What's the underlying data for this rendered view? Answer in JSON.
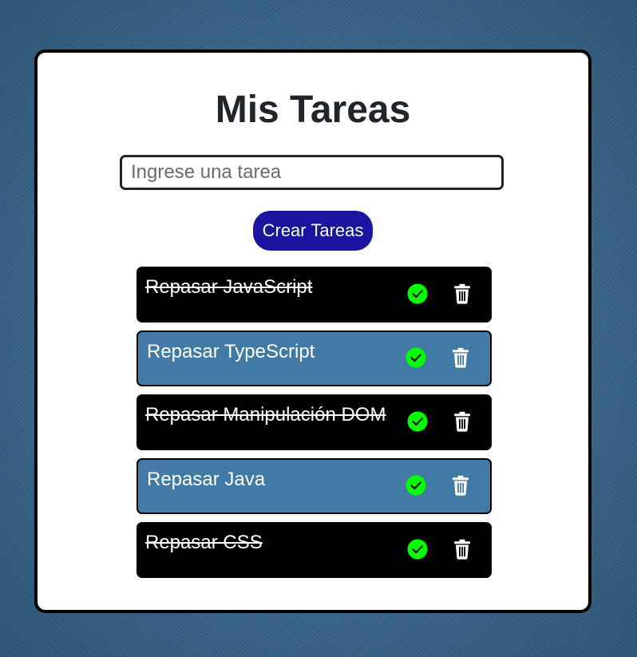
{
  "app": {
    "title": "Mis Tareas"
  },
  "form": {
    "input_placeholder": "Ingrese una tarea",
    "input_value": "",
    "create_label": "Crear Tareas"
  },
  "tasks": [
    {
      "label": "Repasar JavaScript",
      "completed": true
    },
    {
      "label": "Repasar TypeScript",
      "completed": false
    },
    {
      "label": "Repasar Manipulación DOM",
      "completed": true
    },
    {
      "label": "Repasar Java",
      "completed": false
    },
    {
      "label": "Repasar CSS",
      "completed": true
    }
  ],
  "icons": {
    "complete": "check-circle-icon",
    "delete": "trash-icon"
  },
  "colors": {
    "completed_bg": "#000000",
    "pending_bg": "#427aa6",
    "check_green": "#00ff00",
    "button_bg": "#1c14a1"
  }
}
